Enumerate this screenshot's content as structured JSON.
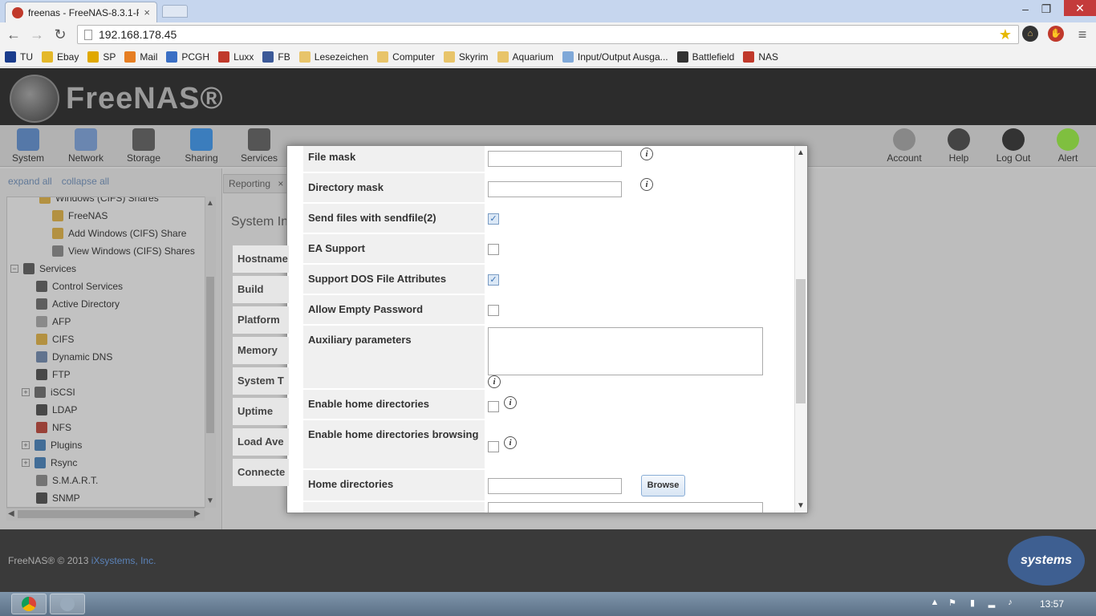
{
  "browser": {
    "tab_title": "freenas - FreeNAS-8.3.1-R",
    "tab_close": "×",
    "url": "192.168.178.45",
    "bookmarks": [
      {
        "label": "TU",
        "color": "#1a3c8c"
      },
      {
        "label": "Ebay",
        "color": "#e4b82a"
      },
      {
        "label": "SP",
        "color": "#e0a800"
      },
      {
        "label": "Mail",
        "color": "#e67e22"
      },
      {
        "label": "PCGH",
        "color": "#3a6fc4"
      },
      {
        "label": "Luxx",
        "color": "#c0392b"
      },
      {
        "label": "FB",
        "color": "#3b5998"
      },
      {
        "label": "Lesezeichen",
        "color": "#e8c46a"
      },
      {
        "label": "Computer",
        "color": "#e8c46a"
      },
      {
        "label": "Skyrim",
        "color": "#e8c46a"
      },
      {
        "label": "Aquarium",
        "color": "#e8c46a"
      },
      {
        "label": "Input/Output Ausga...",
        "color": "#7fa8d8"
      },
      {
        "label": "Battlefield",
        "color": "#333333"
      },
      {
        "label": "NAS",
        "color": "#c0392b"
      }
    ]
  },
  "app": {
    "logo_text": "FreeNAS®",
    "expand_all": "expand all",
    "collapse_all": "collapse all",
    "toolbar_left": [
      {
        "label": "System",
        "color": "#5578a8"
      },
      {
        "label": "Network",
        "color": "#6a86b0"
      },
      {
        "label": "Storage",
        "color": "#555555"
      },
      {
        "label": "Sharing",
        "color": "#3b7dbd"
      },
      {
        "label": "Services",
        "color": "#555555"
      }
    ],
    "toolbar_right": [
      {
        "label": "Account",
        "color": "#888888"
      },
      {
        "label": "Help",
        "color": "#444444"
      },
      {
        "label": "Log Out",
        "color": "#333333"
      },
      {
        "label": "Alert",
        "color": "#7fbf3f"
      }
    ]
  },
  "tree": {
    "items": [
      {
        "label": "Windows (CIFS) Shares",
        "color": "#e8b43a"
      },
      {
        "label": "FreeNAS",
        "color": "#e8b43a"
      },
      {
        "label": "Add Windows (CIFS) Share",
        "color": "#e8b43a"
      },
      {
        "label": "View Windows (CIFS) Shares",
        "color": "#888888"
      },
      {
        "label": "Services",
        "color": "#555555"
      },
      {
        "label": "Control Services",
        "color": "#555555"
      },
      {
        "label": "Active Directory",
        "color": "#666666"
      },
      {
        "label": "AFP",
        "color": "#aaaaaa"
      },
      {
        "label": "CIFS",
        "color": "#e8b43a"
      },
      {
        "label": "Dynamic DNS",
        "color": "#6a86b0"
      },
      {
        "label": "FTP",
        "color": "#444444"
      },
      {
        "label": "iSCSI",
        "color": "#666666"
      },
      {
        "label": "LDAP",
        "color": "#444444"
      },
      {
        "label": "NFS",
        "color": "#c0392b"
      },
      {
        "label": "Plugins",
        "color": "#3b7dbd"
      },
      {
        "label": "Rsync",
        "color": "#3b7dbd"
      },
      {
        "label": "S.M.A.R.T.",
        "color": "#888888"
      },
      {
        "label": "SNMP",
        "color": "#444444"
      }
    ],
    "expander_plus": "+",
    "expander_minus": "−"
  },
  "main": {
    "tab_reporting": "Reporting",
    "tab_close": "×",
    "section_title": "System In",
    "info_rows": [
      "Hostname",
      "Build",
      "Platform",
      "Memory",
      "System T",
      "Uptime",
      "Load Ave",
      "Connecte"
    ]
  },
  "dialog": {
    "info_glyph": "i",
    "check_glyph": "✓",
    "fields": {
      "file_mask": "File mask",
      "directory_mask": "Directory mask",
      "sendfile": "Send files with sendfile(2)",
      "ea_support": "EA Support",
      "dos_attrs": "Support DOS File Attributes",
      "empty_password": "Allow Empty Password",
      "aux_params": "Auxiliary parameters",
      "home_dirs": "Enable home directories",
      "home_dirs_browsing": "Enable home directories browsing",
      "home_directories": "Home directories",
      "browse": "Browse"
    },
    "values": {
      "file_mask": "",
      "directory_mask": "",
      "sendfile": true,
      "ea_support": false,
      "dos_attrs": true,
      "empty_password": false,
      "aux_params": "",
      "home_dirs": false,
      "home_dirs_browsing": false,
      "home_directories": ""
    }
  },
  "footer": {
    "copyright": "FreeNAS® © 2013",
    "company_link": "iXsystems, Inc.",
    "logo_text": "systems"
  },
  "taskbar": {
    "clock": "13:57"
  }
}
